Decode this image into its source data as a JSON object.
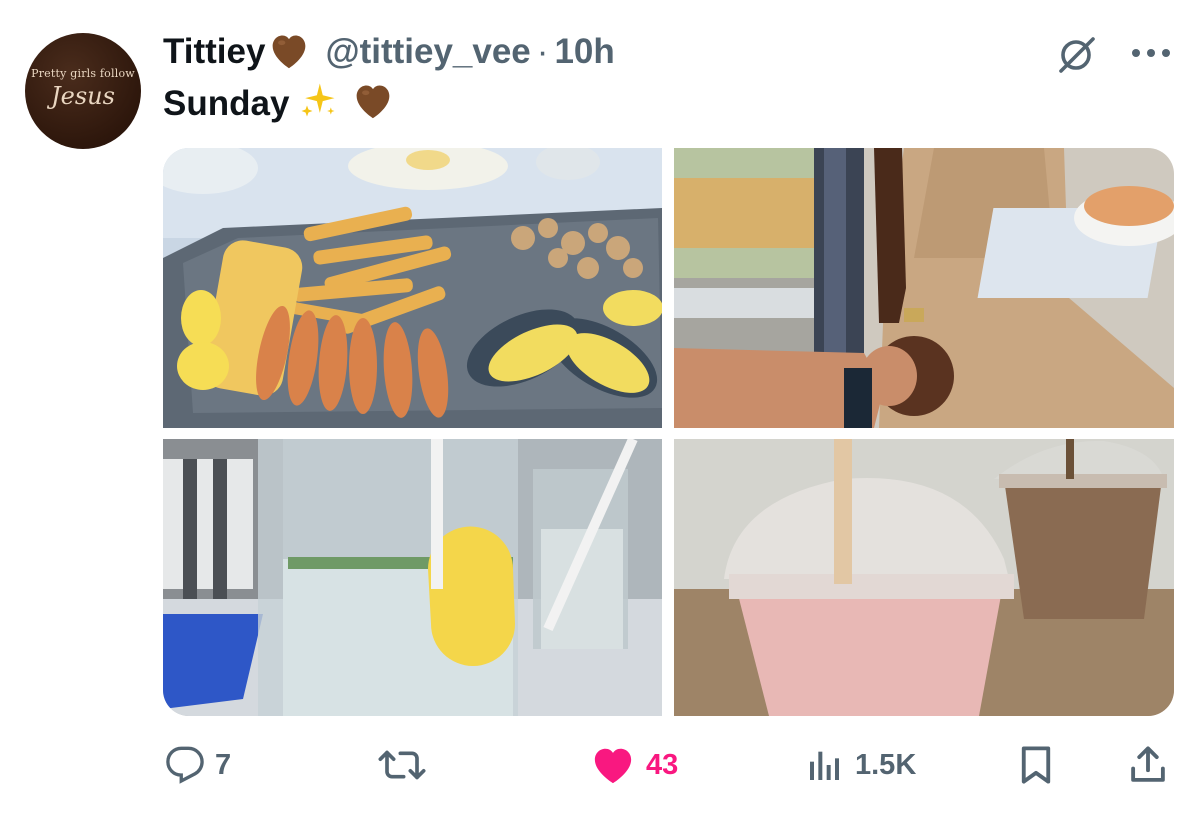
{
  "tweet": {
    "display_name": "Tittiey",
    "handle": "@tittiey_vee",
    "separator": "·",
    "time": "10h",
    "text": "Sunday",
    "avatar": {
      "line1": "Pretty girls follow",
      "line2": "Jesus"
    },
    "icons": {
      "name_emoji": "brown-heart-icon",
      "text_emoji1": "sparkles-icon",
      "text_emoji2": "brown-heart-icon",
      "grok": "grok-icon",
      "more": "more-icon"
    },
    "photos": [
      {
        "name": "seafood-platter-photo"
      },
      {
        "name": "holding-hands-photo"
      },
      {
        "name": "lemon-water-photo"
      },
      {
        "name": "milkshakes-photo"
      }
    ]
  },
  "actions": {
    "replies": "7",
    "retweets": "",
    "likes": "43",
    "views": "1.5K"
  },
  "colors": {
    "secondary_text": "#536471",
    "like_pink": "#f91880",
    "brown_heart": "#7a4a27"
  }
}
